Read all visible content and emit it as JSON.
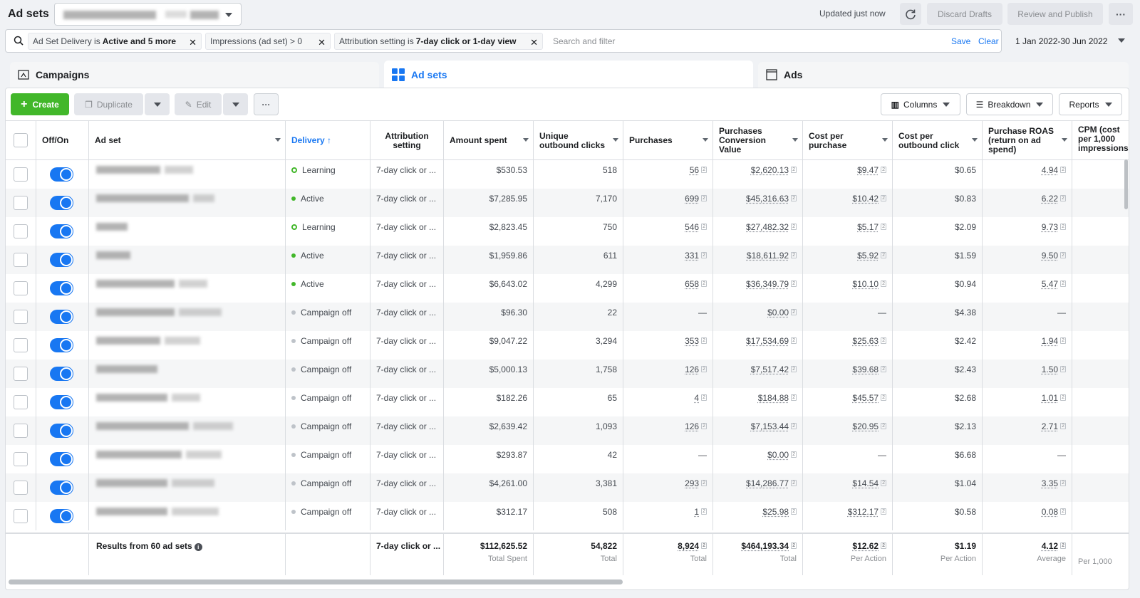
{
  "header": {
    "title": "Ad sets",
    "updated": "Updated just now",
    "discard_label": "Discard Drafts",
    "review_label": "Review and Publish",
    "more_label": "···"
  },
  "filters": {
    "chip1_prefix": "Ad Set Delivery is",
    "chip1_value": "Active and 5 more",
    "chip2_prefix": "Impressions (ad set) > 0",
    "chip3_prefix": "Attribution setting is",
    "chip3_value": "7-day click or 1-day view",
    "search_placeholder": "Search and filter",
    "save": "Save",
    "clear": "Clear",
    "date_range": "1 Jan 2022-30 Jun 2022"
  },
  "tabs": {
    "campaigns": "Campaigns",
    "adsets": "Ad sets",
    "ads": "Ads"
  },
  "toolbar": {
    "create": "Create",
    "duplicate": "Duplicate",
    "edit": "Edit",
    "more": "···",
    "columns": "Columns",
    "breakdown": "Breakdown",
    "reports": "Reports"
  },
  "columns": {
    "offon": "Off/On",
    "adset": "Ad set",
    "delivery": "Delivery ↑",
    "attribution": "Attribution setting",
    "amount": "Amount spent",
    "clicks": "Unique outbound clicks",
    "purchases": "Purchases",
    "value": "Purchases Conversion Value",
    "cpp": "Cost per purchase",
    "cpoc": "Cost per outbound click",
    "roas": "Purchase ROAS (return on ad spend)",
    "cpm": "CPM (cost per 1,000 impressions)"
  },
  "rows": [
    {
      "delivery": "Learning",
      "status": "learning",
      "attribution": "7-day click or ...",
      "amount": "$530.53",
      "clicks": "518",
      "purchases": "56",
      "value": "$2,620.13",
      "cpp": "$9.47",
      "cpoc": "$0.65",
      "roas": "4.94"
    },
    {
      "delivery": "Active",
      "status": "active",
      "attribution": "7-day click or ...",
      "amount": "$7,285.95",
      "clicks": "7,170",
      "purchases": "699",
      "value": "$45,316.63",
      "cpp": "$10.42",
      "cpoc": "$0.83",
      "roas": "6.22"
    },
    {
      "delivery": "Learning",
      "status": "learning",
      "attribution": "7-day click or ...",
      "amount": "$2,823.45",
      "clicks": "750",
      "purchases": "546",
      "value": "$27,482.32",
      "cpp": "$5.17",
      "cpoc": "$2.09",
      "roas": "9.73"
    },
    {
      "delivery": "Active",
      "status": "active",
      "attribution": "7-day click or ...",
      "amount": "$1,959.86",
      "clicks": "611",
      "purchases": "331",
      "value": "$18,611.92",
      "cpp": "$5.92",
      "cpoc": "$1.59",
      "roas": "9.50"
    },
    {
      "delivery": "Active",
      "status": "active",
      "attribution": "7-day click or ...",
      "amount": "$6,643.02",
      "clicks": "4,299",
      "purchases": "658",
      "value": "$36,349.79",
      "cpp": "$10.10",
      "cpoc": "$0.94",
      "roas": "5.47"
    },
    {
      "delivery": "Campaign off",
      "status": "off",
      "attribution": "7-day click or ...",
      "amount": "$96.30",
      "clicks": "22",
      "purchases": "—",
      "value": "$0.00",
      "cpp": "—",
      "cpoc": "$4.38",
      "roas": "—"
    },
    {
      "delivery": "Campaign off",
      "status": "off",
      "attribution": "7-day click or ...",
      "amount": "$9,047.22",
      "clicks": "3,294",
      "purchases": "353",
      "value": "$17,534.69",
      "cpp": "$25.63",
      "cpoc": "$2.42",
      "roas": "1.94"
    },
    {
      "delivery": "Campaign off",
      "status": "off",
      "attribution": "7-day click or ...",
      "amount": "$5,000.13",
      "clicks": "1,758",
      "purchases": "126",
      "value": "$7,517.42",
      "cpp": "$39.68",
      "cpoc": "$2.43",
      "roas": "1.50"
    },
    {
      "delivery": "Campaign off",
      "status": "off",
      "attribution": "7-day click or ...",
      "amount": "$182.26",
      "clicks": "65",
      "purchases": "4",
      "value": "$184.88",
      "cpp": "$45.57",
      "cpoc": "$2.68",
      "roas": "1.01"
    },
    {
      "delivery": "Campaign off",
      "status": "off",
      "attribution": "7-day click or ...",
      "amount": "$2,639.42",
      "clicks": "1,093",
      "purchases": "126",
      "value": "$7,153.44",
      "cpp": "$20.95",
      "cpoc": "$2.13",
      "roas": "2.71"
    },
    {
      "delivery": "Campaign off",
      "status": "off",
      "attribution": "7-day click or ...",
      "amount": "$293.87",
      "clicks": "42",
      "purchases": "—",
      "value": "$0.00",
      "cpp": "—",
      "cpoc": "$6.68",
      "roas": "—"
    },
    {
      "delivery": "Campaign off",
      "status": "off",
      "attribution": "7-day click or ...",
      "amount": "$4,261.00",
      "clicks": "3,381",
      "purchases": "293",
      "value": "$14,286.77",
      "cpp": "$14.54",
      "cpoc": "$1.04",
      "roas": "3.35"
    },
    {
      "delivery": "Campaign off",
      "status": "off",
      "attribution": "7-day click or ...",
      "amount": "$312.17",
      "clicks": "508",
      "purchases": "1",
      "value": "$25.98",
      "cpp": "$312.17",
      "cpoc": "$0.58",
      "roas": "0.08"
    }
  ],
  "totals": {
    "label": "Results from 60 ad sets",
    "attribution": "7-day click or ...",
    "amount": "$112,625.52",
    "amount_sub": "Total Spent",
    "clicks": "54,822",
    "clicks_sub": "Total",
    "purchases": "8,924",
    "purchases_sub": "Total",
    "value": "$464,193.34",
    "value_sub": "Total",
    "cpp": "$12.62",
    "cpp_sub": "Per Action",
    "cpoc": "$1.19",
    "cpoc_sub": "Per Action",
    "roas": "4.12",
    "roas_sub": "Average",
    "cpm_sub": "Per 1,000"
  },
  "colors": {
    "accent": "#1877f2",
    "create": "#42b72a",
    "active_dot": "#42b72a",
    "off_dot": "#bec3c9"
  },
  "icons": {
    "search": "search-icon",
    "refresh": "refresh-icon",
    "campaigns": "campaign-folder-icon",
    "adsets": "grid-icon",
    "ads": "ad-square-icon"
  }
}
